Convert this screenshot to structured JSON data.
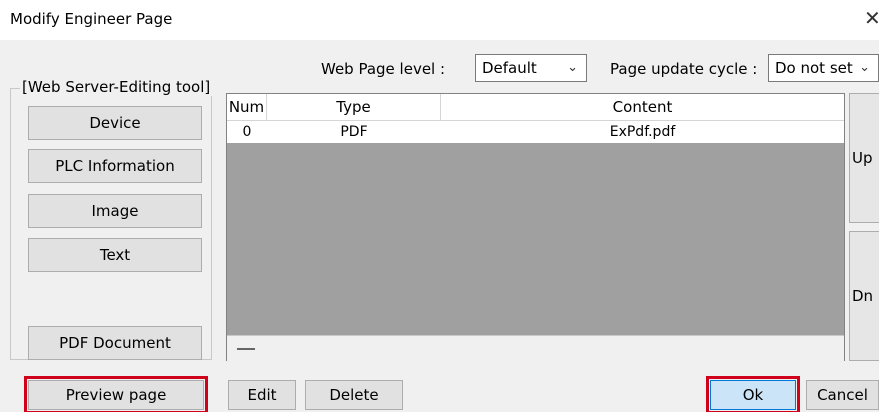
{
  "window": {
    "title": "Modify Engineer Page",
    "close_glyph": "✕"
  },
  "settings": {
    "web_page_level_label": "Web Page level :",
    "web_page_level_value": "Default",
    "page_update_cycle_label": "Page update cycle :",
    "page_update_cycle_value": "Do not set"
  },
  "editing_tool": {
    "title": "[Web Server-Editing tool]",
    "buttons": [
      "Device",
      "PLC Information",
      "Image",
      "Text",
      "PDF Document"
    ]
  },
  "table": {
    "columns": [
      "Num",
      "Type",
      "Content"
    ],
    "rows": [
      {
        "num": "0",
        "type": "PDF",
        "content": "ExPdf.pdf"
      }
    ]
  },
  "side": {
    "up_label": "Up",
    "down_label": "Dn"
  },
  "footer": {
    "preview_label": "Preview page",
    "edit_label": "Edit",
    "delete_label": "Delete",
    "ok_label": "Ok",
    "cancel_label": "Cancel"
  },
  "colors": {
    "highlight": "#d0011b",
    "list_background": "#a0a0a0"
  },
  "icons": {
    "combo_arrow": "chevron-down-icon",
    "close": "close-icon"
  }
}
